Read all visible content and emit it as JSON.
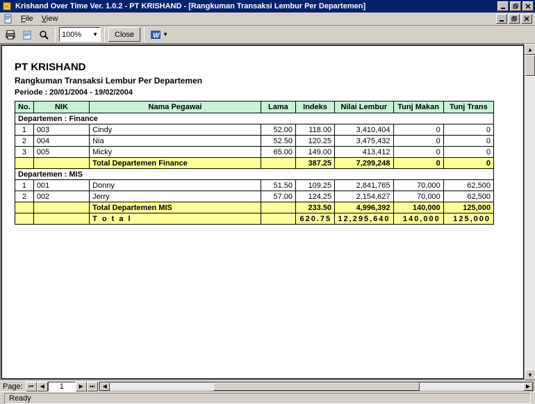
{
  "window": {
    "title": "Krishand Over Time Ver. 1.0.2 - PT KRISHAND - [Rangkuman Transaksi Lembur Per Departemen]"
  },
  "menu": {
    "file": "File",
    "view": "View"
  },
  "toolbar": {
    "zoom": "100%",
    "close": "Close"
  },
  "report": {
    "company": "PT KRISHAND",
    "title": "Rangkuman Transaksi Lembur Per Departemen",
    "period": "Periode : 20/01/2004 - 19/02/2004",
    "columns": {
      "no": "No.",
      "nik": "NIK",
      "name": "Nama Pegawai",
      "lama": "Lama",
      "indeks": "Indeks",
      "nilai": "Nilai Lembur",
      "tunj_makan": "Tunj Makan",
      "tunj_trans": "Tunj Trans"
    },
    "departments": [
      {
        "header": "Departemen : Finance",
        "rows": [
          {
            "no": "1",
            "nik": "003",
            "name": "Cindy",
            "lama": "52.00",
            "indeks": "118.00",
            "nilai": "3,410,404",
            "tmak": "0",
            "ttr": "0"
          },
          {
            "no": "2",
            "nik": "004",
            "name": "Nia",
            "lama": "52.50",
            "indeks": "120.25",
            "nilai": "3,475,432",
            "tmak": "0",
            "ttr": "0"
          },
          {
            "no": "3",
            "nik": "005",
            "name": "Micky",
            "lama": "65.00",
            "indeks": "149.00",
            "nilai": "413,412",
            "tmak": "0",
            "ttr": "0"
          }
        ],
        "subtotal": {
          "label": "Total Departemen Finance",
          "indeks": "387.25",
          "nilai": "7,299,248",
          "tmak": "0",
          "ttr": "0"
        }
      },
      {
        "header": "Departemen : MIS",
        "rows": [
          {
            "no": "1",
            "nik": "001",
            "name": "Donny",
            "lama": "51.50",
            "indeks": "109.25",
            "nilai": "2,841,765",
            "tmak": "70,000",
            "ttr": "62,500"
          },
          {
            "no": "2",
            "nik": "002",
            "name": "Jerry",
            "lama": "57.00",
            "indeks": "124.25",
            "nilai": "2,154,627",
            "tmak": "70,000",
            "ttr": "62,500"
          }
        ],
        "subtotal": {
          "label": "Total Departemen MIS",
          "indeks": "233.50",
          "nilai": "4,996,392",
          "tmak": "140,000",
          "ttr": "125,000"
        }
      }
    ],
    "grandtotal": {
      "label": "T o t a l",
      "indeks": "620.75",
      "nilai": "12,295,640",
      "tmak": "140,000",
      "ttr": "125,000"
    }
  },
  "footer": {
    "page_label": "Page:",
    "page_value": "1",
    "status": "Ready"
  }
}
